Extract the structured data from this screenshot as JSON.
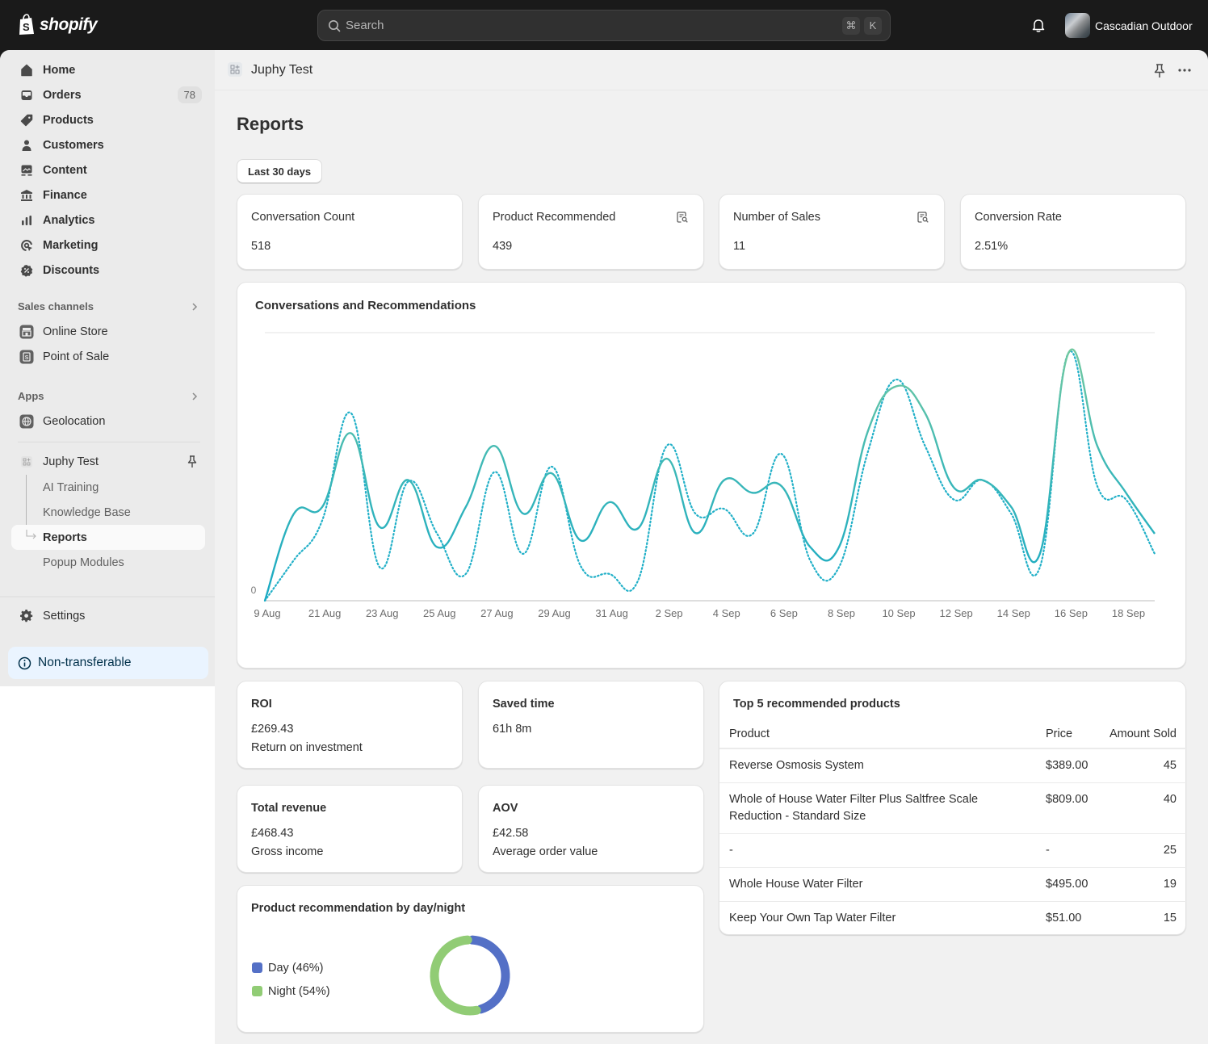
{
  "topbar": {
    "brand": "shopify",
    "search_placeholder": "Search",
    "shortcut_keys": [
      "⌘",
      "K"
    ],
    "store_name": "Cascadian Outdoor"
  },
  "sidebar": {
    "items": [
      {
        "label": "Home",
        "icon": "home-icon"
      },
      {
        "label": "Orders",
        "icon": "inbox-icon",
        "badge": "78"
      },
      {
        "label": "Products",
        "icon": "tag-icon"
      },
      {
        "label": "Customers",
        "icon": "person-icon"
      },
      {
        "label": "Content",
        "icon": "image-icon"
      },
      {
        "label": "Finance",
        "icon": "bank-icon"
      },
      {
        "label": "Analytics",
        "icon": "bar-chart-icon"
      },
      {
        "label": "Marketing",
        "icon": "target-icon"
      },
      {
        "label": "Discounts",
        "icon": "discount-icon"
      }
    ],
    "sales_channels": {
      "header": "Sales channels",
      "items": [
        {
          "label": "Online Store",
          "icon": "store-icon"
        },
        {
          "label": "Point of Sale",
          "icon": "pos-icon"
        }
      ]
    },
    "apps": {
      "header": "Apps",
      "items": [
        {
          "label": "Geolocation",
          "icon": "globe-icon"
        }
      ]
    },
    "app": {
      "label": "Juphy Test",
      "sub_items": [
        {
          "label": "AI Training",
          "active": false
        },
        {
          "label": "Knowledge Base",
          "active": false
        },
        {
          "label": "Reports",
          "active": true
        },
        {
          "label": "Popup Modules",
          "active": false
        }
      ]
    },
    "settings_label": "Settings",
    "non_transferable_label": "Non-transferable"
  },
  "header": {
    "app_title": "Juphy Test"
  },
  "page": {
    "title": "Reports",
    "date_range": "Last 30 days"
  },
  "kpis": [
    {
      "title": "Conversation Count",
      "value": "518",
      "has_icon": false
    },
    {
      "title": "Product Recommended",
      "value": "439",
      "has_icon": true
    },
    {
      "title": "Number of Sales",
      "value": "11",
      "has_icon": true
    },
    {
      "title": "Conversion Rate",
      "value": "2.51%",
      "has_icon": false
    }
  ],
  "metrics": [
    {
      "title": "ROI",
      "value": "£269.43",
      "subtitle": "Return on investment"
    },
    {
      "title": "Saved time",
      "value": "61h 8m",
      "subtitle": ""
    },
    {
      "title": "Total revenue",
      "value": "£468.43",
      "subtitle": "Gross income"
    },
    {
      "title": "AOV",
      "value": "£42.58",
      "subtitle": "Average order value"
    }
  ],
  "top_products": {
    "title": "Top 5 recommended products",
    "columns": [
      "Product",
      "Price",
      "Amount Sold"
    ],
    "rows": [
      {
        "product": "Reverse Osmosis System",
        "price": "$389.00",
        "sold": "45"
      },
      {
        "product": "Whole of House Water Filter Plus Saltfree Scale Reduction - Standard Size",
        "price": "$809.00",
        "sold": "40"
      },
      {
        "product": "-",
        "price": "-",
        "sold": "25"
      },
      {
        "product": "Whole House Water Filter",
        "price": "$495.00",
        "sold": "19"
      },
      {
        "product": "Keep Your Own Tap Water Filter",
        "price": "$51.00",
        "sold": "15"
      }
    ]
  },
  "chart_data": [
    {
      "type": "line",
      "title": "Conversations and Recommendations",
      "xlabel": "",
      "ylabel": "",
      "y_tick_labels": [
        "0"
      ],
      "ylim": [
        0,
        40
      ],
      "grid": true,
      "x_tick_labels": [
        "9 Aug",
        "21 Aug",
        "23 Aug",
        "25 Aug",
        "27 Aug",
        "29 Aug",
        "31 Aug",
        "2 Sep",
        "4 Sep",
        "6 Sep",
        "8 Sep",
        "10 Sep",
        "12 Sep",
        "14 Sep",
        "16 Sep",
        "18 Sep"
      ],
      "x": [
        "9 Aug",
        "20 Aug",
        "21 Aug",
        "22 Aug",
        "23 Aug",
        "24 Aug",
        "25 Aug",
        "26 Aug",
        "27 Aug",
        "28 Aug",
        "29 Aug",
        "30 Aug",
        "31 Aug",
        "1 Sep",
        "2 Sep",
        "3 Sep",
        "4 Sep",
        "5 Sep",
        "6 Sep",
        "7 Sep",
        "8 Sep",
        "9 Sep",
        "10 Sep",
        "11 Sep",
        "12 Sep",
        "13 Sep",
        "14 Sep",
        "15 Sep",
        "16 Sep",
        "17 Sep",
        "18 Sep",
        "19 Sep"
      ],
      "series": [
        {
          "name": "Conversations",
          "style": "solid",
          "color": "#2aaebe",
          "values": [
            0,
            12.9,
            14.0,
            25.0,
            11.0,
            18.0,
            8.0,
            14.0,
            23.1,
            13.0,
            19.0,
            9.0,
            14.7,
            10.8,
            21.2,
            10.1,
            18.0,
            16.1,
            17.1,
            8.0,
            8.0,
            25.2,
            32.0,
            28.0,
            16.9,
            18.0,
            14.0,
            7.0,
            37.0,
            23.1,
            16.1,
            10.0
          ]
        },
        {
          "name": "Recommendations",
          "style": "dotted",
          "color": "#22b0c8",
          "values": [
            0,
            6.0,
            12.0,
            28.0,
            5.0,
            17.8,
            10.0,
            4.0,
            19.2,
            7.0,
            20.0,
            5.2,
            4.0,
            3.0,
            23.1,
            13.0,
            13.7,
            10.0,
            21.9,
            6.0,
            5.0,
            22.1,
            33.0,
            23.1,
            15.1,
            18.0,
            13.0,
            5.0,
            37.0,
            17.1,
            15.1,
            7.0
          ]
        }
      ]
    },
    {
      "type": "pie",
      "title": "Product recommendation by day/night",
      "legend": "left",
      "slices": [
        {
          "label": "Day (46%)",
          "name": "Day",
          "value": 46,
          "color": "#5470c6"
        },
        {
          "label": "Night (54%)",
          "name": "Night",
          "value": 54,
          "color": "#91cc75"
        }
      ]
    }
  ]
}
